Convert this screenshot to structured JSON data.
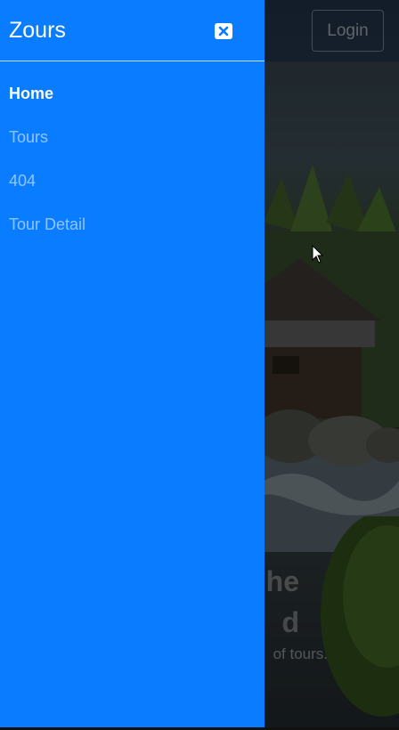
{
  "drawer": {
    "brand": "Zours",
    "close_icon": "close-x-icon",
    "items": [
      {
        "label": "Home",
        "active": true
      },
      {
        "label": "Tours",
        "active": false
      },
      {
        "label": "404",
        "active": false
      },
      {
        "label": "Tour Detail",
        "active": false
      }
    ]
  },
  "navbar": {
    "login_label": "Login"
  },
  "hero": {
    "title_lines": [
      "he",
      "d"
    ],
    "subtitle": "of tours."
  },
  "colors": {
    "drawer_bg": "#0a7cff",
    "drawer_text": "#ffffff"
  }
}
